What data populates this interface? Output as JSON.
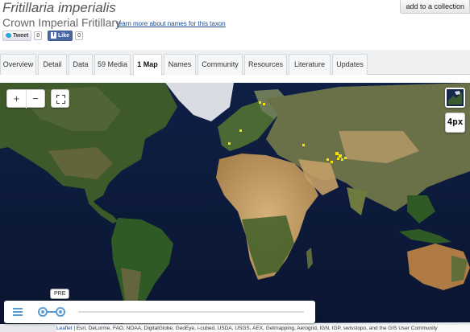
{
  "taxon": {
    "scientific_name": "Fritillaria imperialis",
    "common_name": "Crown Imperial Fritillary",
    "learn_more_link": "learn more about names for this taxon"
  },
  "actions": {
    "add_to_collection": "add to a collection"
  },
  "social": {
    "tweet_label": "Tweet",
    "tweet_count": "0",
    "like_label": "Like",
    "like_count": "0"
  },
  "tabs": [
    {
      "label": "Overview",
      "active": false
    },
    {
      "label": "Detail",
      "active": false
    },
    {
      "label": "Data",
      "active": false
    },
    {
      "label": "59 Media",
      "active": false
    },
    {
      "label": "1 Map",
      "active": true
    },
    {
      "label": "Names",
      "active": false
    },
    {
      "label": "Community",
      "active": false
    },
    {
      "label": "Resources",
      "active": false
    },
    {
      "label": "Literature",
      "active": false
    },
    {
      "label": "Updates",
      "active": false
    }
  ],
  "map": {
    "zoom_in": "+",
    "zoom_out": "−",
    "px_toggle": "4px",
    "timeline_label": "PRE",
    "attribution_link": "Leaflet",
    "attribution_text": " | Esri, DeLorme, FAO, NOAA, DigitalGlobe, GeoEye, i-cubed, USDA, USGS, AEX, Getmapping, Aerogrid, IGN, IGP, swisstopo, and the GIS User Community"
  },
  "colors": {
    "ocean": "#0d1a3a",
    "occurrence": "#f5e400",
    "timeline_accent": "#5a9bd3"
  }
}
